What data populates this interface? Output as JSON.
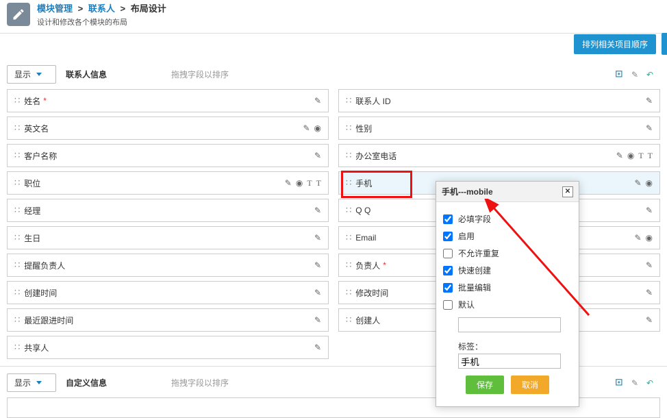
{
  "header": {
    "breadcrumb1": "模块管理",
    "breadcrumb2": "联系人",
    "breadcrumb3": "布局设计",
    "desc": "设计和修改各个模块的布局",
    "sort_btn": "排列相关项目顺序"
  },
  "section1": {
    "display_btn": "显示",
    "title": "联系人信息",
    "hint": "拖拽字段以排序"
  },
  "left_fields": [
    {
      "label": "姓名",
      "required": true,
      "actions": [
        "edit"
      ]
    },
    {
      "label": "英文名",
      "required": false,
      "actions": [
        "edit",
        "eye"
      ]
    },
    {
      "label": "客户名称",
      "required": false,
      "actions": [
        "edit"
      ]
    },
    {
      "label": "职位",
      "required": false,
      "actions": [
        "edit",
        "eye",
        "t1",
        "t2"
      ]
    },
    {
      "label": "经理",
      "required": false,
      "actions": [
        "edit"
      ]
    },
    {
      "label": "生日",
      "required": false,
      "actions": [
        "edit"
      ]
    },
    {
      "label": "提醒负责人",
      "required": false,
      "actions": [
        "edit"
      ]
    },
    {
      "label": "创建时间",
      "required": false,
      "actions": [
        "edit"
      ]
    },
    {
      "label": "最近跟进时间",
      "required": false,
      "actions": [
        "edit"
      ]
    },
    {
      "label": "共享人",
      "required": false,
      "actions": [
        "edit"
      ]
    }
  ],
  "right_fields": [
    {
      "label": "联系人 ID",
      "required": false,
      "actions": [
        "edit"
      ]
    },
    {
      "label": "性别",
      "required": false,
      "actions": [
        "edit"
      ]
    },
    {
      "label": "办公室电话",
      "required": false,
      "actions": [
        "edit",
        "eye",
        "t1",
        "t2"
      ]
    },
    {
      "label": "手机",
      "required": false,
      "actions": [
        "edit",
        "eye"
      ],
      "hl": true
    },
    {
      "label": "Q Q",
      "required": false,
      "actions": [
        "edit"
      ]
    },
    {
      "label": "Email",
      "required": false,
      "actions": [
        "edit",
        "eye"
      ]
    },
    {
      "label": "负责人",
      "required": true,
      "actions": [
        "edit"
      ]
    },
    {
      "label": "修改时间",
      "required": false,
      "actions": [
        "edit"
      ]
    },
    {
      "label": "创建人",
      "required": false,
      "actions": [
        "edit"
      ]
    }
  ],
  "section2": {
    "display_btn": "显示",
    "title": "自定义信息",
    "hint": "拖拽字段以排序"
  },
  "popup": {
    "title": "手机---mobile",
    "opts": [
      {
        "label": "必填字段",
        "checked": true
      },
      {
        "label": "启用",
        "checked": true
      },
      {
        "label": "不允许重复",
        "checked": false
      },
      {
        "label": "快速创建",
        "checked": true
      },
      {
        "label": "批量编辑",
        "checked": true
      }
    ],
    "default_label": "默认",
    "tag_label": "标签：",
    "tag_value": "手机",
    "save": "保存",
    "cancel": "取消"
  },
  "icons": {
    "edit": "✎",
    "eye": "◉",
    "t": "T"
  }
}
